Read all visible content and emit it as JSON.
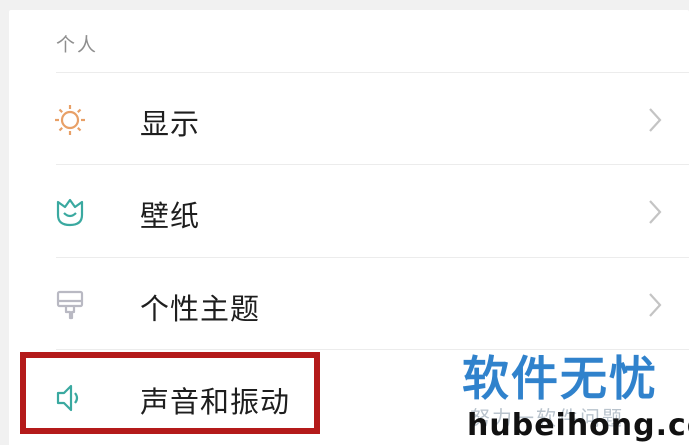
{
  "section": {
    "header": "个人"
  },
  "items": [
    {
      "label": "显示",
      "icon": "brightness-icon"
    },
    {
      "label": "壁纸",
      "icon": "wallpaper-icon"
    },
    {
      "label": "个性主题",
      "icon": "theme-brush-icon"
    },
    {
      "label": "声音和振动",
      "icon": "speaker-icon"
    }
  ],
  "watermark": {
    "brand": "软件无忧",
    "tagline": "努力一软件问题",
    "url": "hubeihong.com"
  },
  "colors": {
    "orange_icon": "#e8a067",
    "teal_icon": "#3aa9a0",
    "theme_icon": "#b9b9c3",
    "highlight": "#b41a1a",
    "watermark_blue": "#1f78c8"
  }
}
